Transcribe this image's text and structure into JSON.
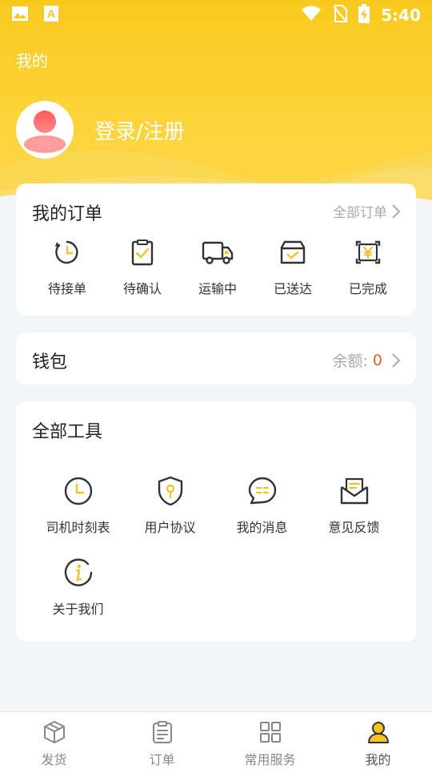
{
  "status_bar": {
    "time": "5:40",
    "icons": [
      "gallery-icon",
      "font-a-icon",
      "wifi-icon",
      "no-sim-icon",
      "battery-charging-icon"
    ]
  },
  "colors": {
    "accent": "#f9c91e",
    "balance": "#f05a2c",
    "icon_yellow": "#f5c320",
    "icon_dark": "#333333"
  },
  "header": {
    "title": "我的",
    "login_text": "登录/注册",
    "avatar_icon": "user-avatar-icon"
  },
  "orders": {
    "title": "我的订单",
    "all_link": "全部订单",
    "items": [
      {
        "label": "待接单",
        "icon": "pending-timer-icon"
      },
      {
        "label": "待确认",
        "icon": "clipboard-check-icon"
      },
      {
        "label": "运输中",
        "icon": "truck-icon"
      },
      {
        "label": "已送达",
        "icon": "box-check-icon"
      },
      {
        "label": "已完成",
        "icon": "yuan-receipt-icon"
      }
    ]
  },
  "wallet": {
    "title": "钱包",
    "balance_label": "余额:",
    "balance_value": "0"
  },
  "tools": {
    "title": "全部工具",
    "items": [
      {
        "label": "司机时刻表",
        "icon": "clock-icon"
      },
      {
        "label": "用户协议",
        "icon": "shield-icon"
      },
      {
        "label": "我的消息",
        "icon": "chat-bubble-icon"
      },
      {
        "label": "意见反馈",
        "icon": "envelope-icon"
      },
      {
        "label": "关于我们",
        "icon": "info-icon"
      }
    ]
  },
  "tabbar": {
    "tabs": [
      {
        "label": "发货",
        "icon": "cube-icon"
      },
      {
        "label": "订单",
        "icon": "clipboard-list-icon"
      },
      {
        "label": "常用服务",
        "icon": "grid-icon"
      },
      {
        "label": "我的",
        "icon": "person-icon",
        "active": true
      }
    ]
  }
}
